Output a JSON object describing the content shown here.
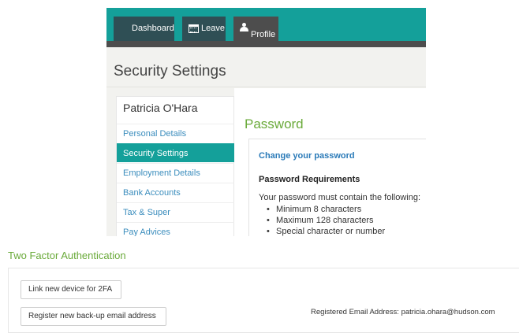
{
  "nav": {
    "tabs": [
      {
        "label": "Dashboard",
        "icon": "dashboard-grid-icon"
      },
      {
        "label": "Leave",
        "icon": "calendar-icon"
      },
      {
        "label": "Profile",
        "icon": "user-icon",
        "active": true
      }
    ]
  },
  "page": {
    "title": "Security Settings"
  },
  "sidebar": {
    "name": "Patricia O'Hara",
    "items": [
      {
        "label": "Personal Details"
      },
      {
        "label": "Security Settings",
        "active": true
      },
      {
        "label": "Employment Details"
      },
      {
        "label": "Bank Accounts"
      },
      {
        "label": "Tax & Super"
      },
      {
        "label": "Pay Advices"
      }
    ]
  },
  "password": {
    "title": "Password",
    "change_link": "Change your password",
    "requirements_heading": "Password Requirements",
    "requirements_intro": "Your password must contain the following:",
    "requirements": [
      "Minimum 8 characters",
      "Maximum 128 characters",
      "Special character or number"
    ]
  },
  "two_factor": {
    "title": "Two Factor Authentication",
    "link_device_button": "Link new device for 2FA",
    "register_email_button": "Register new back-up email address",
    "registered_email_text": "Registered Email Address: patricia.ohara@hudson.com"
  },
  "colors": {
    "teal": "#14a09a",
    "green": "#6aaa3a",
    "link_blue": "#2a7ab8",
    "dark_tab": "#2f4f55"
  }
}
